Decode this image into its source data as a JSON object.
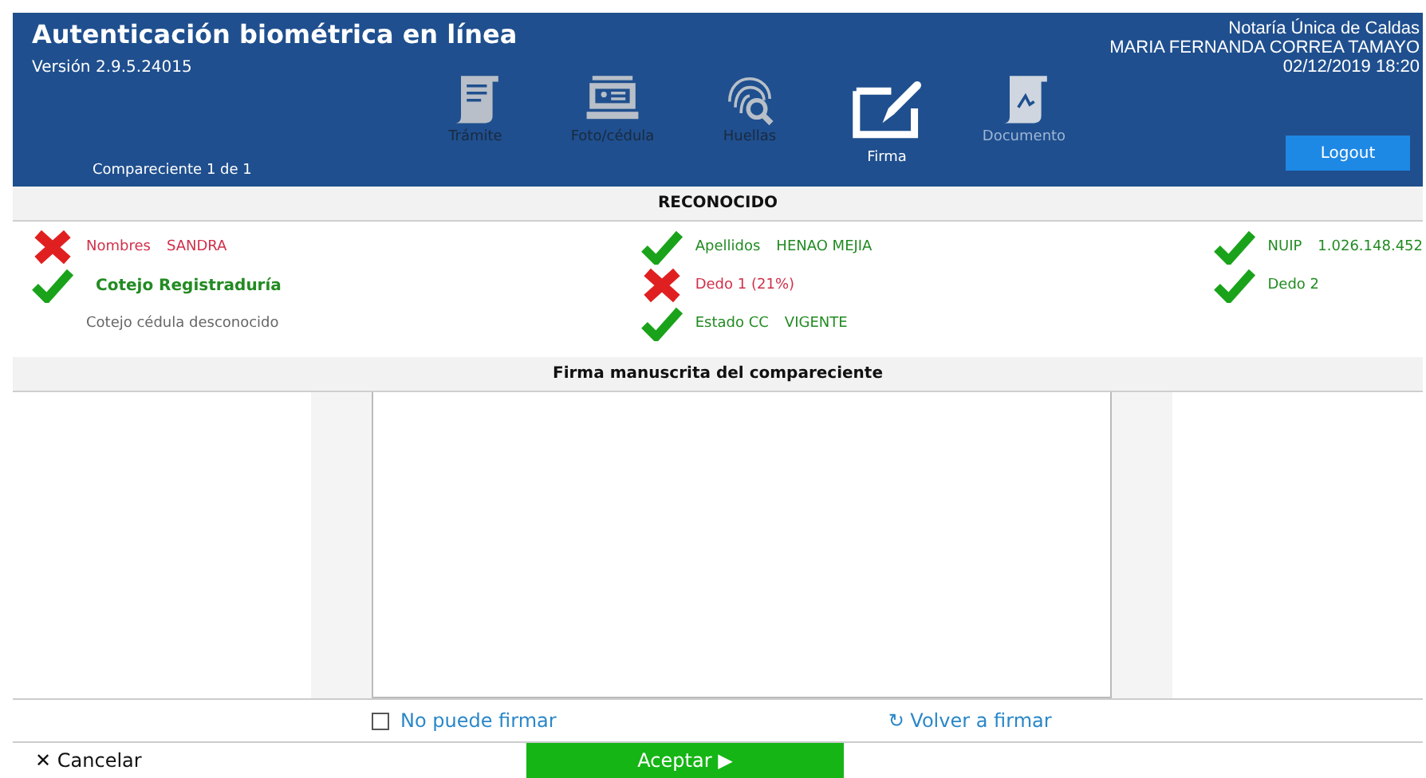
{
  "header": {
    "title": "Autenticación biométrica en línea",
    "version": "Versión 2.9.5.24015",
    "subtitle": "Compareciente 1 de 1",
    "office": "Notaría Única de Caldas",
    "user": "MARIA FERNANDA CORREA TAMAYO",
    "datetime": "02/12/2019 18:20",
    "logout": "Logout"
  },
  "steps": [
    {
      "label": "Trámite",
      "kind": "scroll",
      "selected": false,
      "disabled": false
    },
    {
      "label": "Foto/cédula",
      "kind": "id-card",
      "selected": false,
      "disabled": false
    },
    {
      "label": "Huellas",
      "kind": "fingerprint",
      "selected": false,
      "disabled": false
    },
    {
      "label": "Firma",
      "kind": "sign",
      "selected": true,
      "disabled": false
    },
    {
      "label": "Documento",
      "kind": "document",
      "selected": false,
      "disabled": true
    }
  ],
  "result": {
    "title": "RECONOCIDO"
  },
  "checks": [
    [
      {
        "label": "Nombres",
        "value": "SANDRA",
        "kind": "fail",
        "bold": false
      },
      {
        "label": "Cotejo Registraduría",
        "kind": "ok",
        "bold": true
      },
      {
        "label": "Cotejo cédula desconocido",
        "kind": "info",
        "bold": false
      }
    ],
    [
      {
        "label": "Apellidos",
        "value": "HENAO MEJIA",
        "kind": "ok",
        "bold": false
      },
      {
        "label": "Dedo 1 (21%)",
        "kind": "fail",
        "bold": false
      },
      {
        "label": "Estado CC",
        "value": "VIGENTE",
        "kind": "ok",
        "bold": false
      }
    ],
    [
      {
        "label": "NUIP",
        "value": "1.026.148.452",
        "kind": "ok",
        "bold": false
      },
      {
        "label": "Dedo 2",
        "kind": "ok",
        "bold": false
      }
    ]
  ],
  "signature": {
    "title": "Firma manuscrita del compareciente"
  },
  "options": {
    "cannot_sign": {
      "label": "No puede firmar",
      "checked": false
    },
    "resign": {
      "icon": "↻",
      "label": "Volver a firmar"
    }
  },
  "footer": {
    "cancel_icon": "✕",
    "cancel": "Cancelar",
    "accept": "Aceptar",
    "accept_icon": "▶"
  }
}
